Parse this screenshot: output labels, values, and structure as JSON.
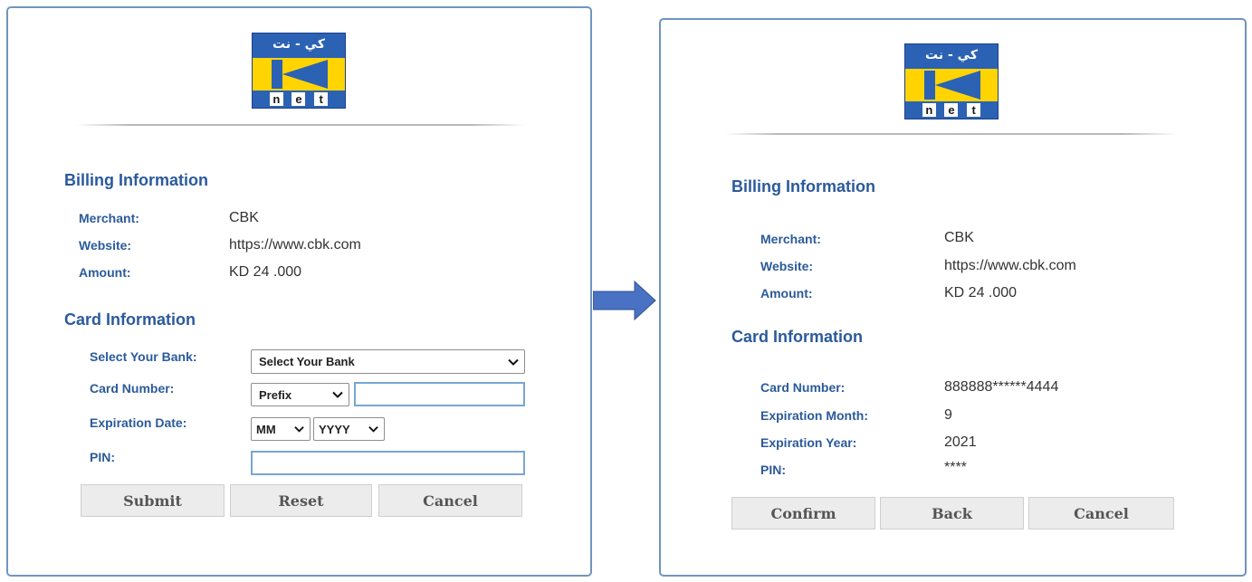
{
  "logo": {
    "arabic_text": "كي - نت",
    "letters": [
      "n",
      "e",
      "t"
    ]
  },
  "left": {
    "billing_title": "Billing Information",
    "billing": [
      {
        "label": "Merchant:",
        "value": "CBK"
      },
      {
        "label": "Website:",
        "value": "https://www.cbk.com"
      },
      {
        "label": "Amount:",
        "value": "KD 24 .000"
      }
    ],
    "card_title": "Card Information",
    "bank_label": "Select Your Bank:",
    "bank_select": "Select Your Bank",
    "card_number_label": "Card Number:",
    "prefix_select": "Prefix",
    "expiration_label": "Expiration Date:",
    "month_select": "MM",
    "year_select": "YYYY",
    "pin_label": "PIN:",
    "buttons": {
      "submit": "Submit",
      "reset": "Reset",
      "cancel": "Cancel"
    }
  },
  "right": {
    "billing_title": "Billing Information",
    "billing": [
      {
        "label": "Merchant:",
        "value": "CBK"
      },
      {
        "label": "Website:",
        "value": "https://www.cbk.com"
      },
      {
        "label": "Amount:",
        "value": "KD 24 .000"
      }
    ],
    "card_title": "Card Information",
    "card": [
      {
        "label": "Card Number:",
        "value": "888888******4444"
      },
      {
        "label": "Expiration Month:",
        "value": "9"
      },
      {
        "label": "Expiration Year:",
        "value": "2021"
      },
      {
        "label": "PIN:",
        "value": "****"
      }
    ],
    "buttons": {
      "confirm": "Confirm",
      "back": "Back",
      "cancel": "Cancel"
    }
  },
  "colors": {
    "accent": "#2b5a9b",
    "panel_border": "#6f95bd",
    "arrow": "#4a72c4",
    "logo_blue": "#2c62b4",
    "logo_yellow": "#ffd400"
  }
}
